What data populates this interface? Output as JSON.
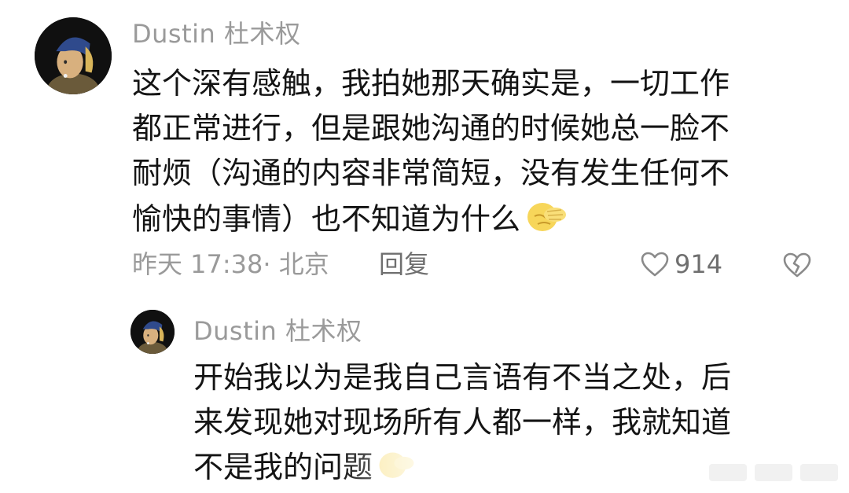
{
  "comment": {
    "username": "Dustin 杜术权",
    "text_lines": [
      "这个深有感触，我拍她那天确实是，一切工作",
      "都正常进行，但是跟她沟通的时候她总一脸不",
      "耐烦（沟通的内容非常简短，没有发生任何不",
      "愉快的事情）也不知道为什么"
    ],
    "emoji": "facepalm-emoji",
    "time_location": "昨天 17:38· 北京",
    "reply_label": "回复",
    "like_count": "914"
  },
  "reply": {
    "username": "Dustin 杜术权",
    "text_lines": [
      "开始我以为是我自己言语有不当之处，后",
      "来发现她对现场所有人都一样，我就知道",
      "不是我的问题"
    ],
    "emoji": "facepalm-emoji"
  },
  "icons": {
    "like": "heart-icon",
    "dislike": "broken-heart-icon"
  },
  "colors": {
    "text": "#141414",
    "meta": "#9a9a9a",
    "action": "#6f6f6f",
    "avatar_scarf": "#2f4a8c",
    "emoji_yellow": "#f7d65a"
  }
}
